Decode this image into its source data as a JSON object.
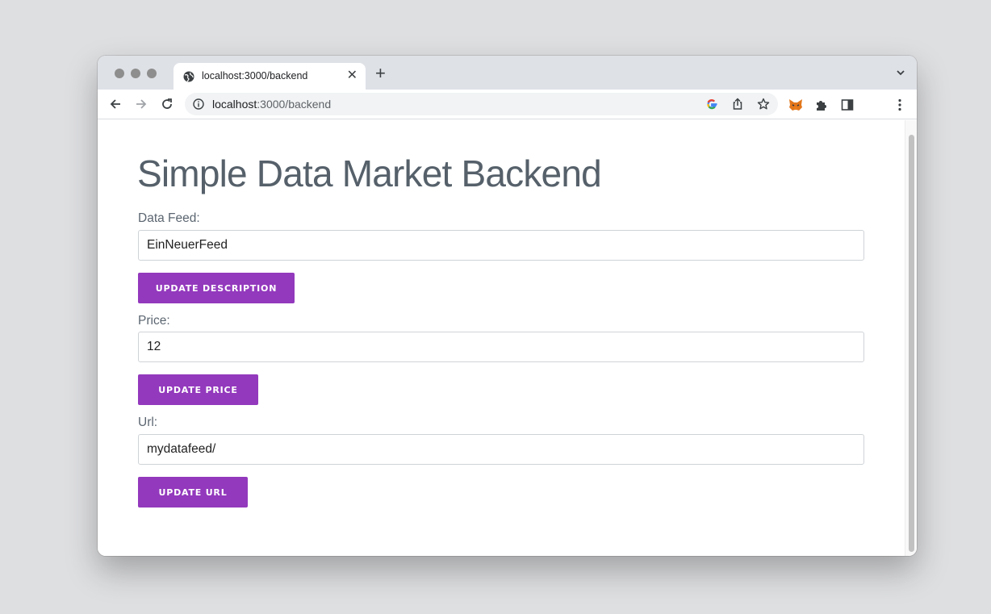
{
  "browser": {
    "tab_title": "localhost:3000/backend",
    "tab_close": "✕",
    "new_tab": "+",
    "url_host": "localhost",
    "url_path": ":3000/backend",
    "icons": [
      "globe-icon",
      "back-icon",
      "forward-icon",
      "reload-icon",
      "info-icon",
      "google-icon",
      "share-icon",
      "star-icon",
      "metamask-icon",
      "extensions-icon",
      "sidepanel-icon",
      "menu-icon",
      "tab-search-icon"
    ]
  },
  "page": {
    "title": "Simple Data Market Backend",
    "feed": {
      "label": "Data Feed:",
      "value": "EinNeuerFeed",
      "button": "UPDATE DESCRIPTION"
    },
    "price": {
      "label": "Price:",
      "value": "12",
      "button": "UPDATE PRICE"
    },
    "url": {
      "label": "Url:",
      "value": "mydatafeed/",
      "button": "UPDATE URL"
    }
  },
  "colors": {
    "accent": "#9339bd",
    "title": "#55606a",
    "background": "#dedfe1"
  }
}
